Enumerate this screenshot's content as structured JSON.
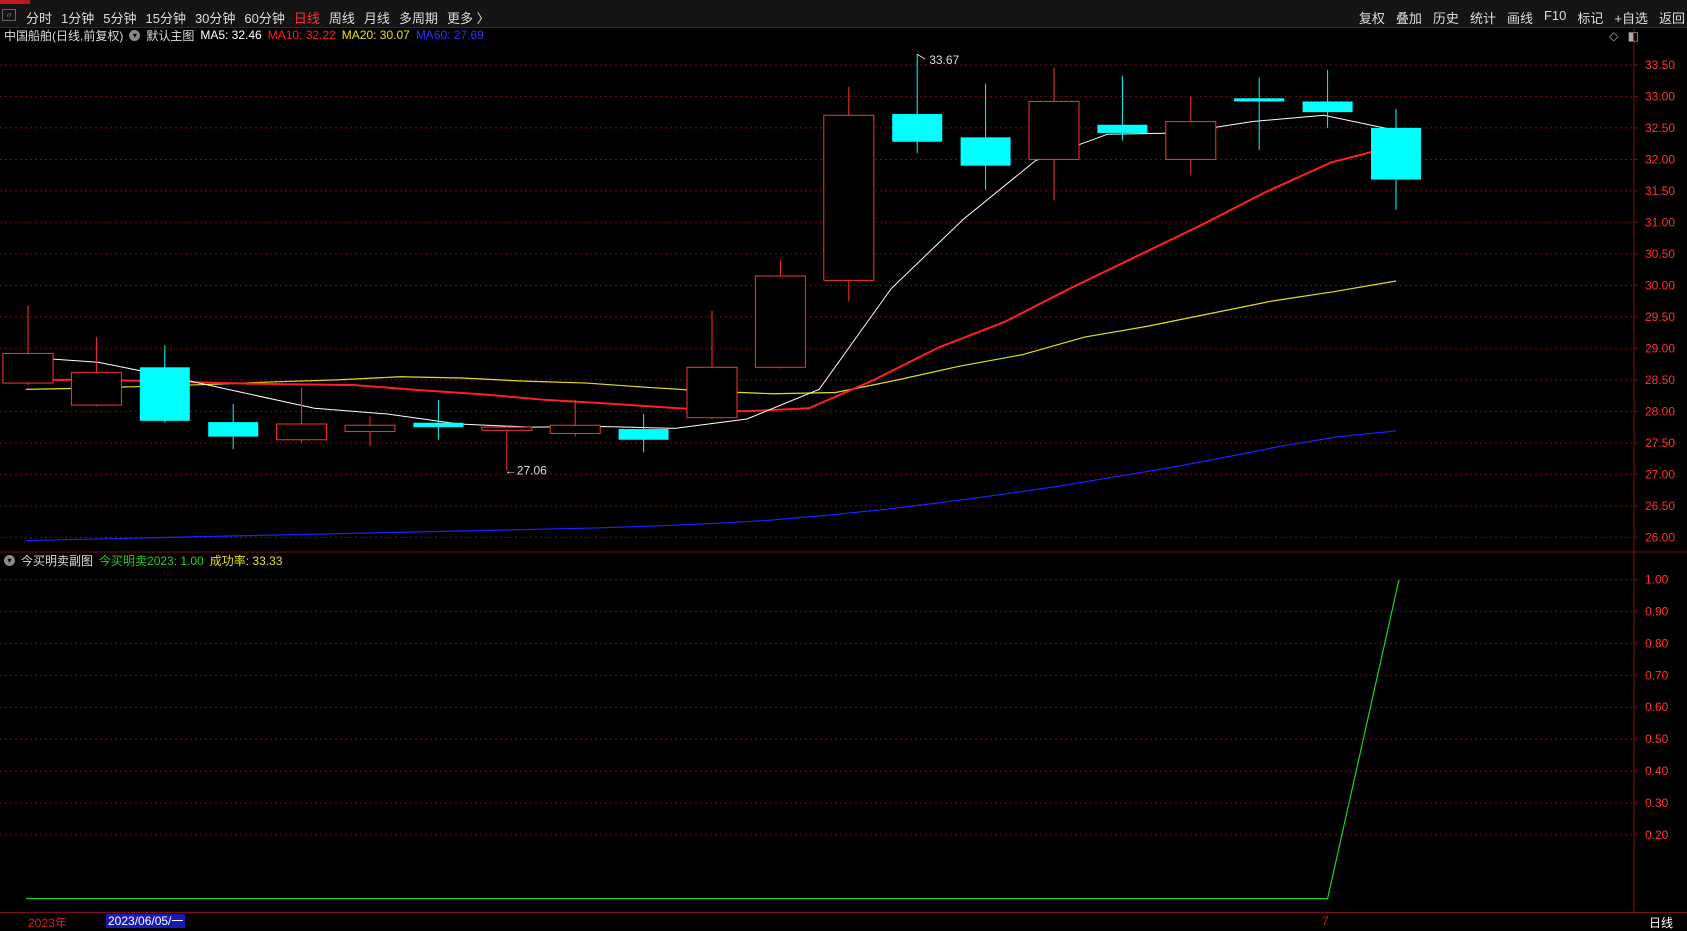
{
  "toolbar": {
    "left": [
      "分时",
      "1分钟",
      "5分钟",
      "15分钟",
      "30分钟",
      "60分钟",
      "日线",
      "周线",
      "月线",
      "多周期",
      "更多 〉"
    ],
    "active_index": 6,
    "right": [
      "复权",
      "叠加",
      "历史",
      "统计",
      "画线",
      "F10",
      "标记",
      "+自选",
      "返回"
    ]
  },
  "main_info": {
    "stock": "中国船舶(日线,前复权)",
    "template": "默认主图",
    "ma5": "MA5: 32.46",
    "ma10": "MA10: 32.22",
    "ma20": "MA20: 30.07",
    "ma60": "MA60: 27.69"
  },
  "sub_info": {
    "title": "今买明卖副图",
    "indicator": "今买明卖2023: 1.00",
    "rate": "成功率: 33.33"
  },
  "bottom": {
    "year": "2023年",
    "selected_date": "2023/06/05/一",
    "mark": "7",
    "period": "日线"
  },
  "colors": {
    "up": "#ff3333",
    "down": "#00ffff",
    "ma5": "#ffffff",
    "ma10": "#ff2020",
    "ma20": "#e0e020",
    "ma60": "#2020ff",
    "indicator": "#20d020",
    "grid": "#7a1010",
    "axis_text": "#ff3333"
  },
  "chart_data": [
    {
      "type": "candlestick",
      "y_ticks": [
        "33.50",
        "33.00",
        "32.50",
        "32.00",
        "31.50",
        "31.00",
        "30.50",
        "30.00",
        "29.50",
        "29.00",
        "28.50",
        "28.00",
        "27.50",
        "27.00",
        "26.50",
        "26.00"
      ],
      "ylim": [
        25.8,
        33.8
      ],
      "candles": [
        {
          "o": 28.45,
          "h": 29.68,
          "l": 28.42,
          "c": 28.92
        },
        {
          "o": 28.1,
          "h": 29.18,
          "l": 28.08,
          "c": 28.62
        },
        {
          "o": 28.7,
          "h": 29.05,
          "l": 27.82,
          "c": 27.85
        },
        {
          "o": 27.83,
          "h": 28.12,
          "l": 27.4,
          "c": 27.6
        },
        {
          "o": 27.55,
          "h": 28.38,
          "l": 27.5,
          "c": 27.8
        },
        {
          "o": 27.68,
          "h": 27.92,
          "l": 27.45,
          "c": 27.78
        },
        {
          "o": 27.82,
          "h": 28.18,
          "l": 27.55,
          "c": 27.75
        },
        {
          "o": 27.7,
          "h": 27.78,
          "l": 27.06,
          "c": 27.75
        },
        {
          "o": 27.65,
          "h": 28.18,
          "l": 27.6,
          "c": 27.78
        },
        {
          "o": 27.72,
          "h": 27.96,
          "l": 27.35,
          "c": 27.55
        },
        {
          "o": 27.9,
          "h": 29.6,
          "l": 27.88,
          "c": 28.7
        },
        {
          "o": 28.7,
          "h": 30.4,
          "l": 28.68,
          "c": 30.15
        },
        {
          "o": 30.08,
          "h": 33.15,
          "l": 29.75,
          "c": 32.7
        },
        {
          "o": 32.72,
          "h": 33.67,
          "l": 32.1,
          "c": 32.28
        },
        {
          "o": 32.35,
          "h": 33.2,
          "l": 31.52,
          "c": 31.9
        },
        {
          "o": 32.0,
          "h": 33.45,
          "l": 31.35,
          "c": 32.92
        },
        {
          "o": 32.55,
          "h": 33.33,
          "l": 32.3,
          "c": 32.42
        },
        {
          "o": 32.0,
          "h": 33.0,
          "l": 31.75,
          "c": 32.6
        },
        {
          "o": 32.97,
          "h": 33.3,
          "l": 32.15,
          "c": 32.92
        },
        {
          "o": 32.92,
          "h": 33.42,
          "l": 32.5,
          "c": 32.75
        },
        {
          "o": 32.5,
          "h": 32.8,
          "l": 31.2,
          "c": 31.68
        }
      ],
      "ma5": [
        28.86,
        28.78,
        28.55,
        28.3,
        28.05,
        27.96,
        27.8,
        27.75,
        27.76,
        27.73,
        27.88,
        28.35,
        29.95,
        31.05,
        31.98,
        32.4,
        32.42,
        32.6,
        32.7,
        32.46
      ],
      "ma10": [
        28.5,
        28.5,
        28.48,
        28.45,
        28.43,
        28.42,
        28.34,
        28.27,
        28.18,
        28.12,
        28.05,
        28.0,
        28.05,
        28.5,
        29.02,
        29.42,
        29.95,
        30.45,
        30.95,
        31.48,
        31.95,
        32.22
      ],
      "ma20": [
        28.35,
        28.37,
        28.4,
        28.43,
        28.47,
        28.5,
        28.55,
        28.53,
        28.48,
        28.45,
        28.38,
        28.32,
        28.28,
        28.3,
        28.5,
        28.72,
        28.9,
        29.18,
        29.35,
        29.55,
        29.75,
        29.9,
        30.07
      ],
      "ma60": [
        25.95,
        25.97,
        25.99,
        26.01,
        26.03,
        26.05,
        26.07,
        26.09,
        26.11,
        26.13,
        26.15,
        26.18,
        26.22,
        26.27,
        26.35,
        26.44,
        26.55,
        26.67,
        26.8,
        26.95,
        27.1,
        27.27,
        27.45,
        27.6,
        27.69
      ],
      "labels": [
        {
          "text": "33.67"
        },
        {
          "text": "←27.06"
        }
      ]
    },
    {
      "type": "line",
      "y_ticks": [
        "1.00",
        "0.90",
        "0.80",
        "0.70",
        "0.60",
        "0.50",
        "0.40",
        "0.30",
        "0.20"
      ],
      "ylim": [
        -0.02,
        1.03
      ],
      "values": [
        0,
        0,
        0,
        0,
        0,
        0,
        0,
        0,
        0,
        0,
        0,
        0,
        0,
        0,
        0,
        0,
        0,
        0,
        0,
        0,
        0,
        1.0
      ]
    }
  ]
}
